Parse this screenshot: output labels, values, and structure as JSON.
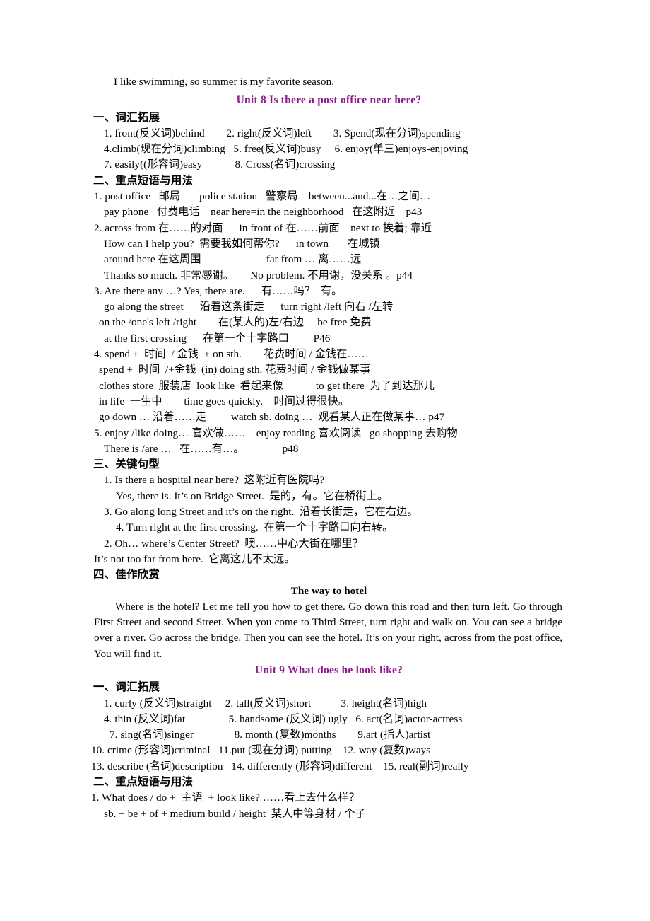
{
  "document": {
    "intro_line": "I like swimming, so summer is my favorite season."
  },
  "unit8": {
    "heading": "Unit 8    Is there a post office near here?",
    "sections": {
      "vocabulary_head": "一、词汇拓展",
      "phrases_head": "二、重点短语与用法",
      "patterns_head": "三、关键句型",
      "essay_head": "四、佳作欣赏"
    },
    "vocabulary": [
      "1. front(反义词)behind        2. right(反义词)left        3. Spend(现在分词)spending",
      "4.climb(现在分词)climbing   5. free(反义词)busy     6. enjoy(单三)enjoys-enjoying",
      "7. easily((形容词)easy            8. Cross(名词)crossing"
    ],
    "phrases": [
      "1. post office   邮局       police station   警察局    between...and...在…之间…",
      "pay phone   付费电话    near here=in the neighborhood   在这附近    p43",
      "2. across from 在……的对面      in front of 在……前面    next to 挨着; 靠近",
      "How can I help you?  需要我如何帮你?      in town       在城镇",
      "around here 在这周围                        far from … 离……远",
      "Thanks so much. 非常感谢。      No problem. 不用谢，没关系 。p44",
      "3. Are there any …? Yes, there are.      有……吗？  有。",
      "go along the street      沿着这条街走      turn right /left 向右 /左转",
      "on the /one's left /right        在(某人的)左/右边     be free 免费",
      "at the first crossing      在第一个十字路口         P46",
      "4. spend +  时间  / 金钱  + on sth.        花费时间 / 金钱在……",
      "spend +  时间  /+金钱  (in) doing sth. 花费时间 / 金钱做某事",
      "clothes store  服装店  look like  看起来像            to get there  为了到达那儿",
      "in life  一生中        time goes quickly.    时间过得很快。",
      "go down … 沿着……走         watch sb. doing …  观看某人正在做某事… p47",
      "5. enjoy /like doing… 喜欢做……    enjoy reading 喜欢阅读   go shopping 去购物",
      "There is /are …   在……有…。              p48"
    ],
    "patterns": [
      "1. Is there a hospital near here?  这附近有医院吗?",
      "Yes, there is. It’s on Bridge Street.  是的，有。它在桥街上。",
      "3. Go along long Street and it’s on the right.  沿着长街走，它在右边。",
      "4. Turn right at the first crossing.  在第一个十字路口向右转。",
      "2. Oh… where’s Center Street?  噢……中心大街在哪里？",
      "It’s not too far from here.  它离这儿不太远。"
    ],
    "essay": {
      "title": "The way to hotel",
      "body": "Where is the hotel? Let me tell you how to get there. Go down this road and then turn left. Go through First Street and second Street. When you come to Third Street, turn right and walk on. You can see a bridge over a river. Go across the bridge. Then you can see the hotel. It’s on your right, across from the post office, You will find it."
    }
  },
  "unit9": {
    "heading": "Unit 9 What does he look like?",
    "sections": {
      "vocabulary_head": "一、词汇拓展",
      "phrases_head": "二、重点短语与用法"
    },
    "vocabulary": [
      "1. curly (反义词)straight     2. tall(反义词)short           3. height(名词)high",
      "4. thin (反义词)fat                5. handsome (反义词) ugly   6. act(名词)actor-actress",
      "7. sing(名词)singer               8. month (复数)months        9.art (指人)artist",
      "10. crime (形容词)criminal   11.put (现在分词) putting    12. way (复数)ways",
      "13. describe (名词)description   14. differently (形容词)different    15. real(副词)really"
    ],
    "phrases": [
      "1. What does / do +  主语  + look like? ……看上去什么样？",
      "sb. + be + of + medium build / height  某人中等身材 / 个子"
    ]
  },
  "colors": {
    "unit_heading": "#8E1A8E",
    "text": "#000000",
    "background": "#FFFFFF"
  }
}
